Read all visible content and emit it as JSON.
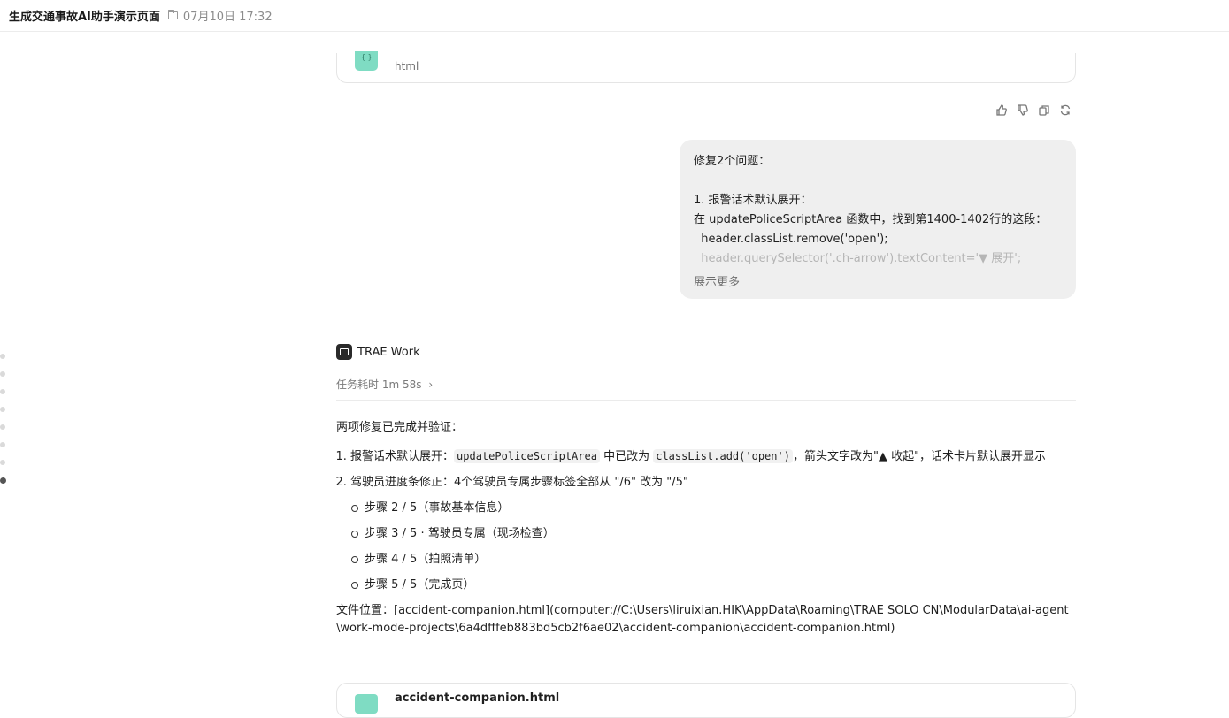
{
  "header": {
    "title": "生成交通事故AI助手演示页面",
    "date": "07月10日 17:32"
  },
  "prev_card": {
    "kind": "html"
  },
  "user_message": {
    "lines": [
      "修复2个问题：",
      "",
      "1. 报警话术默认展开：",
      "在 updatePoliceScriptArea 函数中，找到第1400-1402行的这段：",
      "  header.classList.remove('open');"
    ],
    "faded_line": "  header.querySelector('.ch-arrow').textContent='▼ 展开';",
    "show_more": "展示更多"
  },
  "agent": {
    "name": "TRAE Work",
    "elapsed": "任务耗时 1m 58s"
  },
  "answer": {
    "intro": "两项修复已完成并验证：",
    "item1_prefix": "报警话术默认展开：",
    "item1_code1": "updatePoliceScriptArea",
    "item1_mid": " 中已改为 ",
    "item1_code2": "classList.add('open')",
    "item1_suffix": "，箭头文字改为\"▲ 收起\"，话术卡片默认展开显示",
    "item2": "驾驶员进度条修正：4个驾驶员专属步骤标签全部从 \"/6\" 改为 \"/5\"",
    "subitems": [
      "步骤 2 / 5（事故基本信息）",
      "步骤 3 / 5 · 驾驶员专属（现场检查）",
      "步骤 4 / 5（拍照清单）",
      "步骤 5 / 5（完成页）"
    ],
    "filepath": "文件位置：[accident-companion.html](computer://C:\\Users\\liruixian.HIK\\AppData\\Roaming\\TRAE SOLO CN\\ModularData\\ai-agent\\work-mode-projects\\6a4dfffeb883bd5cb2f6ae02\\accident-companion\\accident-companion.html)"
  },
  "file_card": {
    "name": "accident-companion.html"
  },
  "icons": [
    "folder-icon",
    "like-icon",
    "dislike-icon",
    "copy-icon",
    "refresh-icon",
    "trae-logo-icon",
    "chevron-right-icon",
    "file-icon"
  ]
}
